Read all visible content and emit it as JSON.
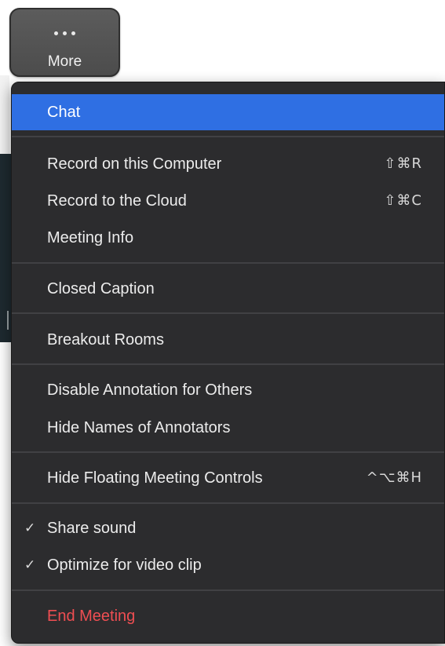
{
  "more_button": {
    "label": "More",
    "icon": "ellipsis-icon"
  },
  "menu": {
    "items": [
      {
        "label": "Chat",
        "selected": true
      },
      {
        "label": "Record on this Computer",
        "shortcut": "⇧⌘R"
      },
      {
        "label": "Record to the Cloud",
        "shortcut": "⇧⌘C"
      },
      {
        "label": "Meeting Info"
      },
      {
        "label": "Closed Caption"
      },
      {
        "label": "Breakout Rooms"
      },
      {
        "label": "Disable Annotation for Others"
      },
      {
        "label": "Hide Names of Annotators"
      },
      {
        "label": "Hide Floating Meeting Controls",
        "shortcut": "^⌥⌘H"
      },
      {
        "label": "Share sound",
        "checked": true,
        "check": "✓"
      },
      {
        "label": "Optimize for video clip",
        "checked": true,
        "check": "✓"
      },
      {
        "label": "End Meeting",
        "danger": true
      }
    ],
    "colors": {
      "background": "#2c2c2e",
      "selected": "#2f6fe3",
      "danger": "#ef4e52",
      "separator": "#414144"
    }
  }
}
